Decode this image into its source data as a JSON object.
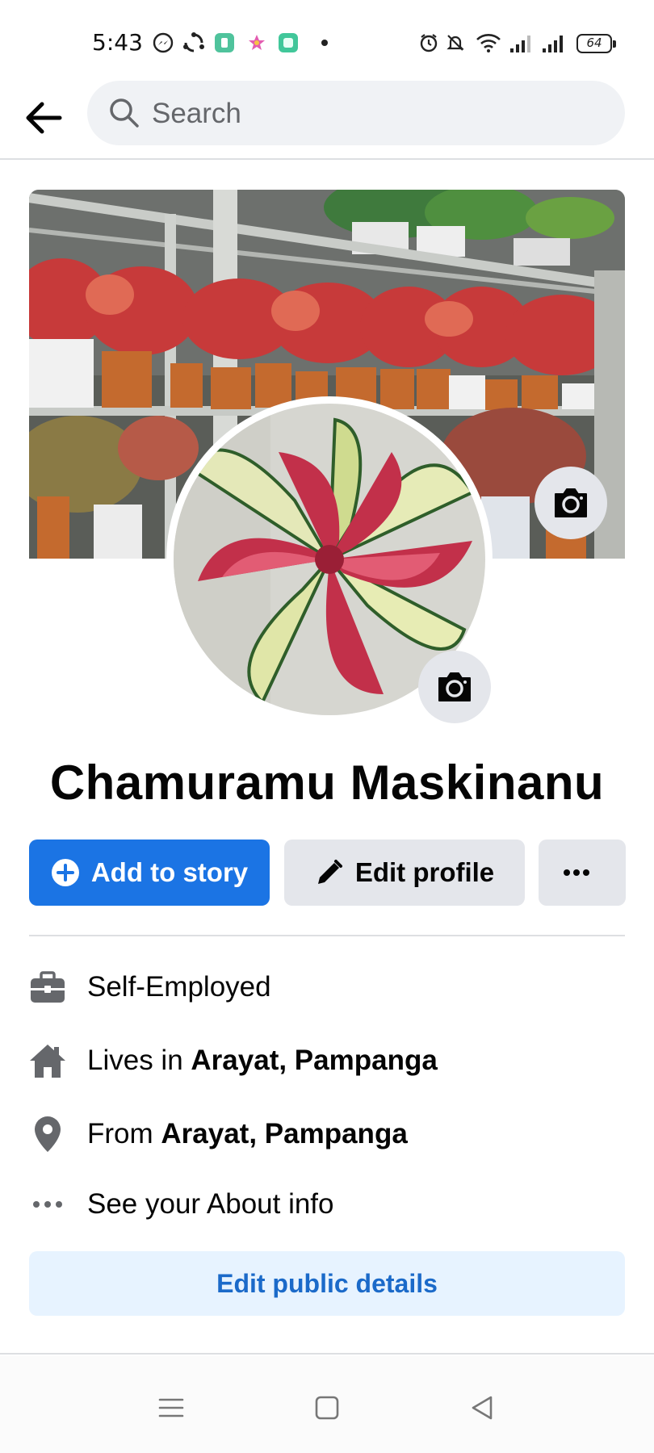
{
  "status_bar": {
    "time": "5:43",
    "battery_level": "64",
    "icons": [
      "messenger-icon",
      "sync-icon",
      "app-icon",
      "star-app-icon",
      "square-app-icon",
      "notification-dot",
      "alarm-icon",
      "mute-icon",
      "wifi-icon",
      "signal-icon",
      "signal-icon-2",
      "battery-icon"
    ]
  },
  "header": {
    "back_icon": "arrow-left-icon",
    "search_placeholder": "Search"
  },
  "profile": {
    "name": "Chamuramu Maskinanu",
    "cover_camera_icon": "camera-icon",
    "avatar_camera_icon": "camera-icon"
  },
  "actions": {
    "add_story": "Add to story",
    "edit_profile": "Edit profile",
    "more_icon": "more-horizontal-icon"
  },
  "details": {
    "work": "Self-Employed",
    "lives_prefix": "Lives in ",
    "lives_place": "Arayat, Pampanga",
    "from_prefix": "From ",
    "from_place": "Arayat, Pampanga",
    "about": "See your About info"
  },
  "edit_public": "Edit public details",
  "colors": {
    "primary": "#1b74e4",
    "secondary_button": "#e4e6eb",
    "public_button_bg": "#e7f3ff",
    "public_button_text": "#1b6ac9",
    "icon_gray": "#65676b"
  },
  "nav_bar": [
    "menu-icon",
    "home-square-icon",
    "back-triangle-icon"
  ]
}
